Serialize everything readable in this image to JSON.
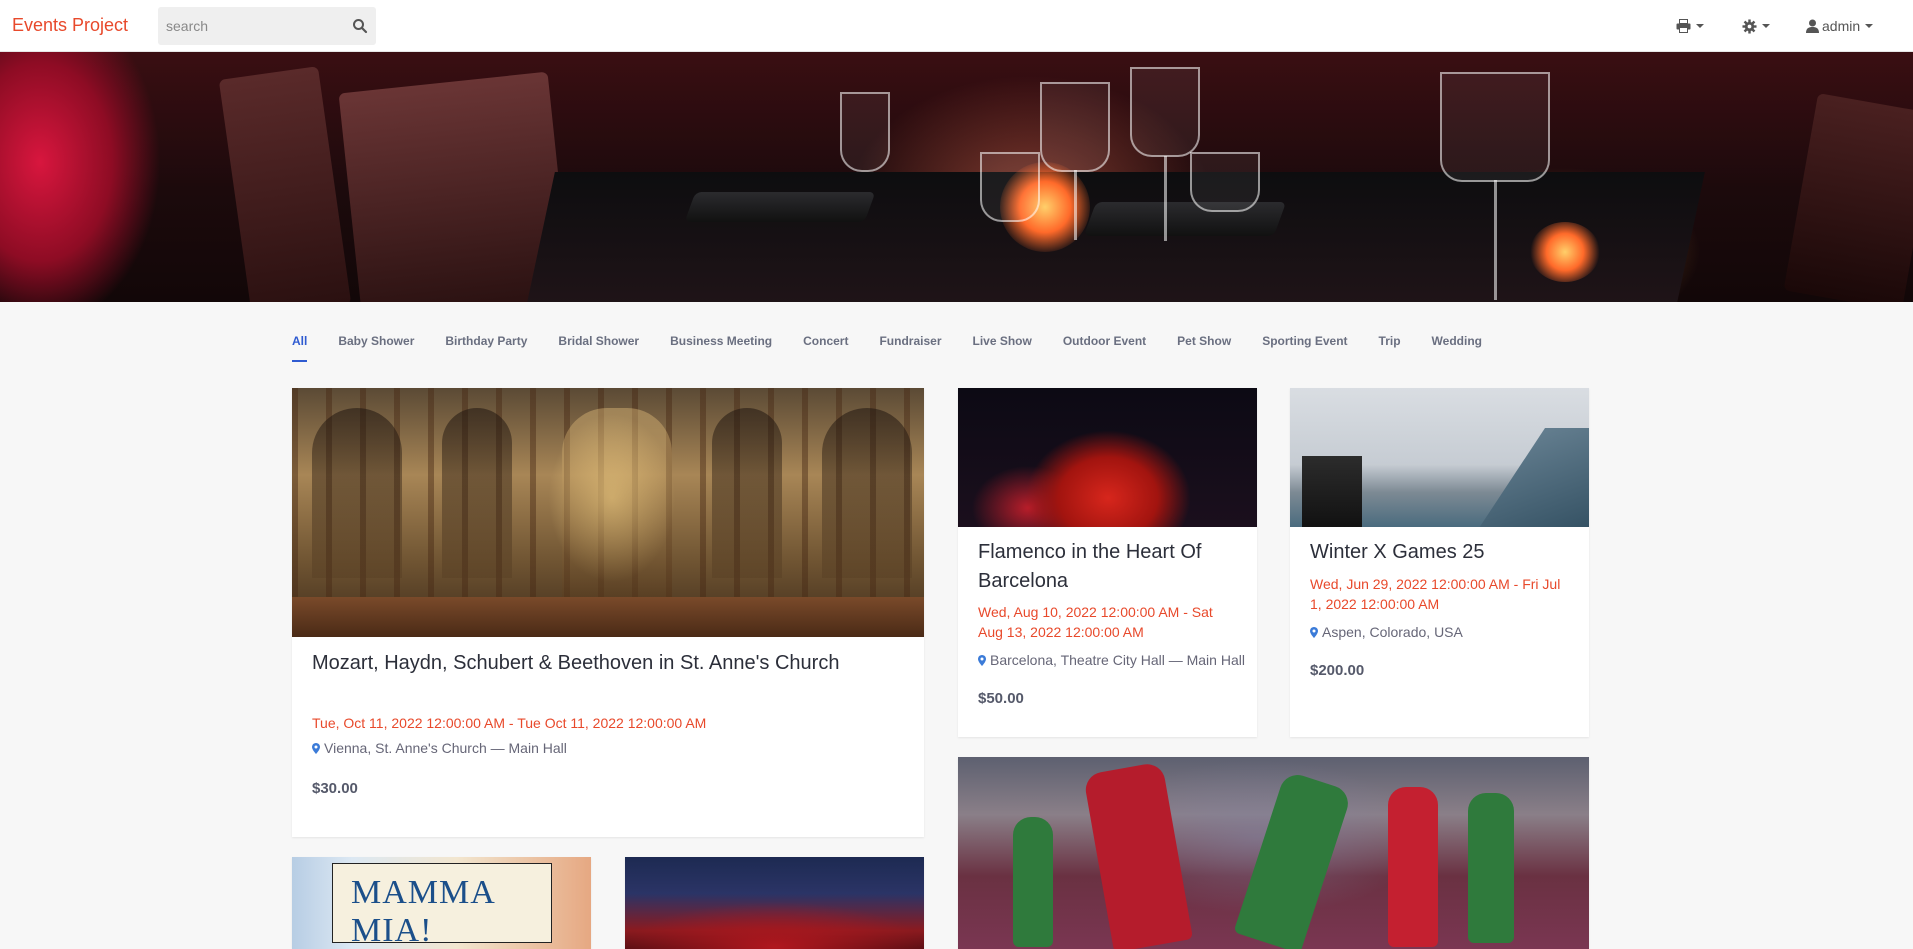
{
  "app": {
    "brand": "Events Project"
  },
  "search": {
    "placeholder": "search"
  },
  "toolbar": {
    "user_label": "admin"
  },
  "tabs": [
    {
      "label": "All",
      "active": true
    },
    {
      "label": "Baby Shower"
    },
    {
      "label": "Birthday Party"
    },
    {
      "label": "Bridal Shower"
    },
    {
      "label": "Business Meeting"
    },
    {
      "label": "Concert"
    },
    {
      "label": "Fundraiser"
    },
    {
      "label": "Live Show"
    },
    {
      "label": "Outdoor Event"
    },
    {
      "label": "Pet Show"
    },
    {
      "label": "Sporting Event"
    },
    {
      "label": "Trip"
    },
    {
      "label": "Wedding"
    }
  ],
  "events": [
    {
      "title": "Mozart, Haydn, Schubert & Beethoven in St. Anne's Church",
      "date": "Tue, Oct 11, 2022 12:00:00 AM - Tue Oct 11, 2022 12:00:00 AM",
      "location": "Vienna, St. Anne's Church — Main Hall",
      "price": "$30.00"
    },
    {
      "title": "Flamenco in the Heart Of Barcelona",
      "date": "Wed, Aug 10, 2022 12:00:00 AM - Sat Aug 13, 2022 12:00:00 AM",
      "location": "Barcelona, Theatre City Hall — Main Hall",
      "price": "$50.00"
    },
    {
      "title": "Winter X Games 25",
      "date": "Wed, Jun 29, 2022 12:00:00 AM - Fri Jul 1, 2022 12:00:00 AM",
      "location": "Aspen, Colorado, USA",
      "price": "$200.00"
    }
  ],
  "posters": {
    "mamma_mia_title": "MAMMA MIA!"
  },
  "colors": {
    "brand": "#e8492b",
    "tab_active": "#2f5bd1",
    "date": "#e8492b",
    "pin": "#3b7bd8"
  },
  "icons": {
    "search": "search-icon",
    "print": "print-icon",
    "settings": "gear-icon",
    "user": "user-icon",
    "location": "map-pin-icon"
  }
}
